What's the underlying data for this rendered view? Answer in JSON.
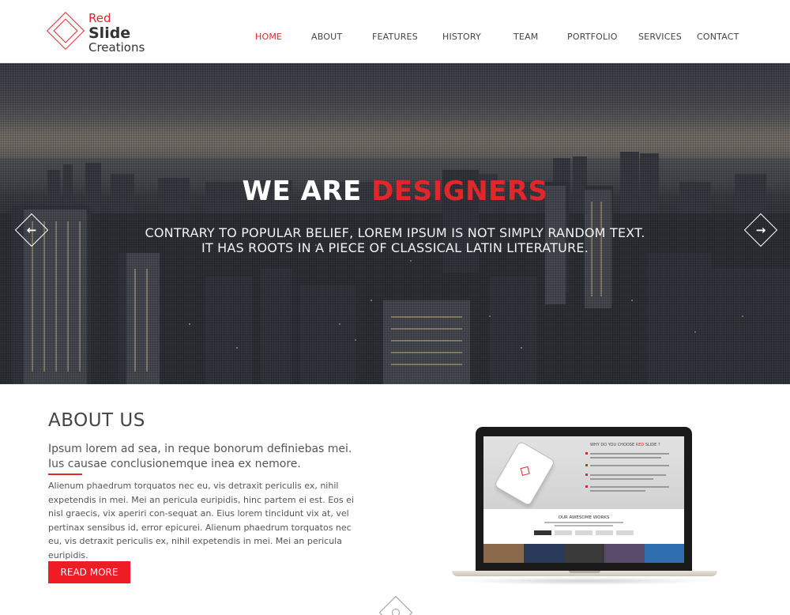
{
  "brand": {
    "line1": "Red",
    "line2": "Slide",
    "line3": "Creations",
    "accent_color": "#e3262b"
  },
  "nav": {
    "items": [
      {
        "label": "HOME",
        "active": true
      },
      {
        "label": "ABOUT",
        "active": false
      },
      {
        "label": "FEATURES",
        "active": false
      },
      {
        "label": "HISTORY",
        "active": false
      },
      {
        "label": "TEAM",
        "active": false
      },
      {
        "label": "PORTFOLIO",
        "active": false
      },
      {
        "label": "SERVICES",
        "active": false
      },
      {
        "label": "CONTACT",
        "active": false
      }
    ]
  },
  "hero": {
    "title_prefix": "WE ARE",
    "title_accent": "DESIGNERS",
    "subtitle_line1": "CONTRARY TO POPULAR BELIEF, LOREM IPSUM IS NOT SIMPLY RANDOM TEXT.",
    "subtitle_line2": "IT HAS ROOTS IN A PIECE OF CLASSICAL LATIN LITERATURE.",
    "prev_icon": "arrow-left-icon",
    "next_icon": "arrow-right-icon"
  },
  "about": {
    "title": "ABOUT US",
    "lead": "Ipsum lorem ad sea, in reque bonorum definiebas mei. Ius causae conclusionemque inea ex nemore.",
    "body": "Alienum phaedrum torquatos nec eu, vis detraxit periculis ex, nihil expetendis in mei. Mei an pericula euripidis, hinc partem ei est. Eos ei nisl graecis, vix aperiri con-sequat an. Eius lorem tincidunt vix at, vel pertinax sensibus id, error epicurei. Alienum phaedrum torquatos nec eu, vis detraxit periculis ex, nihil expetendis in mei. Mei an pericula euripidis.",
    "button": "READ MORE"
  },
  "mockup": {
    "heading_prefix": "WHY DO YOU CHOOSE",
    "heading_accent": "RED",
    "heading_suffix": "SLIDE ?",
    "works_title": "OUR AWESOME WORKS"
  }
}
